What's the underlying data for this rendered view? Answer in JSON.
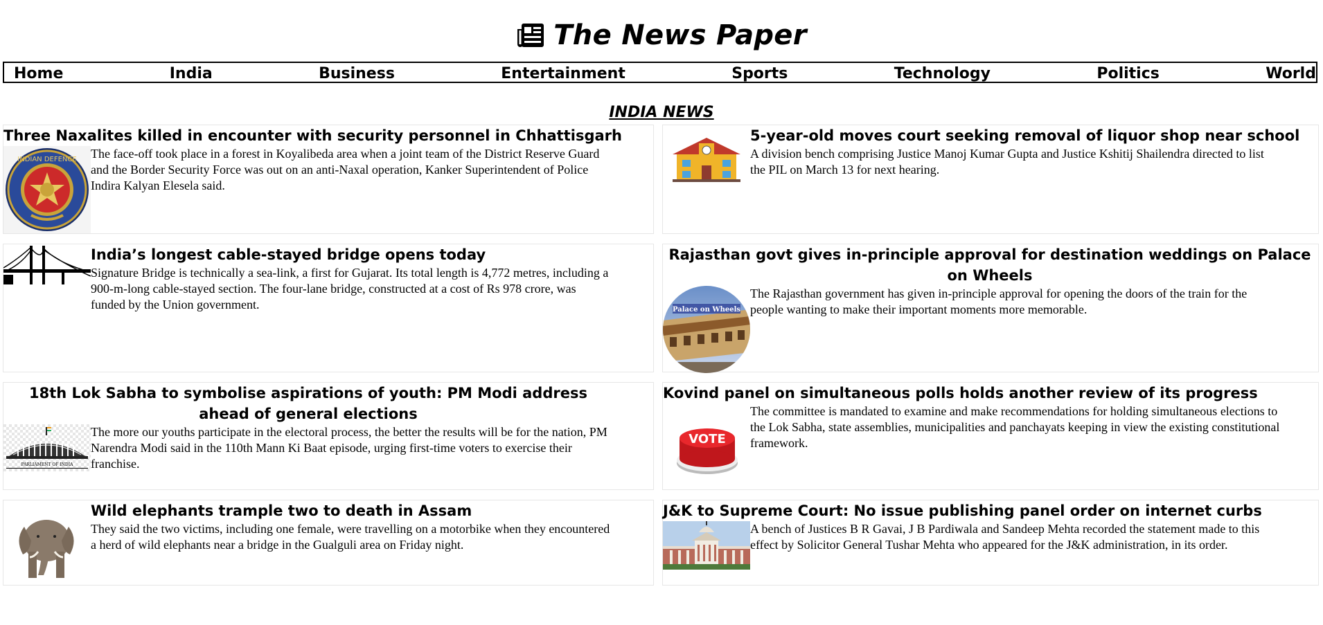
{
  "site": {
    "title": "The News Paper",
    "logo_icon": "newspaper-icon"
  },
  "nav": {
    "items": [
      {
        "label": "Home"
      },
      {
        "label": "India"
      },
      {
        "label": "Business"
      },
      {
        "label": "Entertainment"
      },
      {
        "label": "Sports"
      },
      {
        "label": "Technology"
      },
      {
        "label": "Politics"
      },
      {
        "label": "World"
      }
    ]
  },
  "section": {
    "title": "INDIA NEWS"
  },
  "articles": [
    {
      "headline": "Three Naxalites killed in encounter with security personnel in Chhattisgarh",
      "summary": "The face-off took place in a forest in Koyalibeda area when a joint team of the District Reserve Guard and the Border Security Force was out on an anti-Naxal operation, Kanker Superintendent of Police Indira Kalyan Elesela said.",
      "image": "indian-defence-emblem"
    },
    {
      "headline": "5-year-old moves court seeking removal of liquor shop near school",
      "summary": "A division bench comprising Justice Manoj Kumar Gupta and Justice Kshitij Shailendra directed to list the PIL on March 13 for next hearing.",
      "image": "school-building"
    },
    {
      "headline": "India’s longest cable-stayed bridge opens today",
      "summary": "Signature Bridge is technically a sea-link, a first for Gujarat. Its total length is 4,772 metres, including a 900-m-long cable-stayed section. The four-lane bridge, constructed at a cost of Rs 978 crore, was funded by the Union government.",
      "image": "bridge-silhouette"
    },
    {
      "headline": "Rajasthan govt gives in-principle approval for destination weddings on Palace on Wheels",
      "summary": "The Rajasthan government has given in-principle approval for opening the doors of the train for the people wanting to make their important moments more memorable.",
      "image": "palace-on-wheels-train",
      "image_caption": "Palace on Wheels"
    },
    {
      "headline": "18th Lok Sabha to symbolise aspirations of youth: PM Modi address ahead of general elections",
      "summary": "The more our youths participate in the electoral process, the better the results will be for the nation, PM Narendra Modi said in the 110th Mann Ki Baat episode, urging first-time voters to exercise their franchise.",
      "image": "parliament-of-india",
      "image_caption": "PARLIAMENT OF INDIA"
    },
    {
      "headline": "Kovind panel on simultaneous polls holds another review of its progress",
      "summary": "The committee is mandated to examine and make recommendations for holding simultaneous elections to the Lok Sabha, state assemblies, municipalities and panchayats keeping in view the existing constitutional framework.",
      "image": "vote-button",
      "image_caption": "VOTE"
    },
    {
      "headline": "Wild elephants trample two to death in Assam",
      "summary": "They said the two victims, including one female, were travelling on a motorbike when they encountered a herd of wild elephants near a bridge in the Gualguli area on Friday night.",
      "image": "elephant"
    },
    {
      "headline": "J&K to Supreme Court: No issue publishing panel order on internet curbs",
      "summary": "A bench of Justices B R Gavai, J B Pardiwala and Sandeep Mehta recorded the statement made to this effect by Solicitor General Tushar Mehta who appeared for the J&K administration, in its order.",
      "image": "supreme-court-building"
    }
  ]
}
